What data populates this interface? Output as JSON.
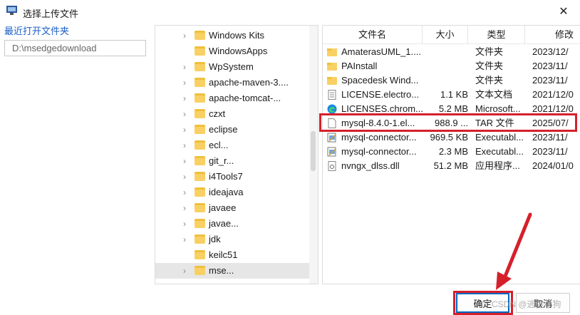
{
  "window": {
    "title": "选择上传文件",
    "close_glyph": "✕"
  },
  "recent": {
    "label": "最近打开文件夹",
    "path": "D:\\msedgedownload"
  },
  "tree": {
    "items": [
      {
        "label": "Windows Kits",
        "expandable": true
      },
      {
        "label": "WindowsApps",
        "expandable": false
      },
      {
        "label": "WpSystem",
        "expandable": true
      },
      {
        "label": "apache-maven-3....",
        "expandable": true
      },
      {
        "label": "apache-tomcat-...",
        "expandable": true
      },
      {
        "label": "czxt",
        "expandable": true
      },
      {
        "label": "eclipse",
        "expandable": true
      },
      {
        "label": "ecl...",
        "expandable": true
      },
      {
        "label": "git_r...",
        "expandable": true
      },
      {
        "label": "i4Tools7",
        "expandable": true
      },
      {
        "label": "ideajava",
        "expandable": true
      },
      {
        "label": "javaee",
        "expandable": true
      },
      {
        "label": "javae...",
        "expandable": true
      },
      {
        "label": "jdk",
        "expandable": true
      },
      {
        "label": "keilc51",
        "expandable": false
      },
      {
        "label": "mse...",
        "expandable": true,
        "selected": true
      }
    ]
  },
  "files": {
    "columns": [
      "文件名",
      "大小",
      "类型",
      "修改"
    ],
    "rows": [
      {
        "icon": "folder-icon",
        "name": "AmaterasUML_1....",
        "size": "",
        "type": "文件夹",
        "modified": "2023/12/"
      },
      {
        "icon": "folder-icon",
        "name": "PAInstall",
        "size": "",
        "type": "文件夹",
        "modified": "2023/11/"
      },
      {
        "icon": "folder-icon",
        "name": "Spacedesk Wind...",
        "size": "",
        "type": "文件夹",
        "modified": "2023/11/"
      },
      {
        "icon": "text-file-icon",
        "name": "LICENSE.electro...",
        "size": "1.1 KB",
        "type": "文本文档",
        "modified": "2021/12/0"
      },
      {
        "icon": "edge-icon",
        "name": "LICENSES.chrom...",
        "size": "5.2 MB",
        "type": "Microsoft...",
        "modified": "2021/12/0"
      },
      {
        "icon": "file-icon",
        "name": "mysql-8.4.0-1.el...",
        "size": "988.9 ...",
        "type": "TAR 文件",
        "modified": "2025/07/"
      },
      {
        "icon": "installer-icon",
        "name": "mysql-connector...",
        "size": "969.5 KB",
        "type": "Executabl...",
        "modified": "2023/11/"
      },
      {
        "icon": "installer-icon",
        "name": "mysql-connector...",
        "size": "2.3 MB",
        "type": "Executabl...",
        "modified": "2023/11/"
      },
      {
        "icon": "dll-file-icon",
        "name": "nvngx_dlss.dll",
        "size": "51.2 MB",
        "type": "应用程序...",
        "modified": "2024/01/0"
      }
    ]
  },
  "buttons": {
    "ok": "确定",
    "cancel": "取消"
  },
  "watermark": "CSDN @逃跑小狗",
  "colors": {
    "accent": "#0067c0",
    "highlight": "#d5202c",
    "folder": "#f8d064",
    "recent_label": "#1a5fc7"
  }
}
